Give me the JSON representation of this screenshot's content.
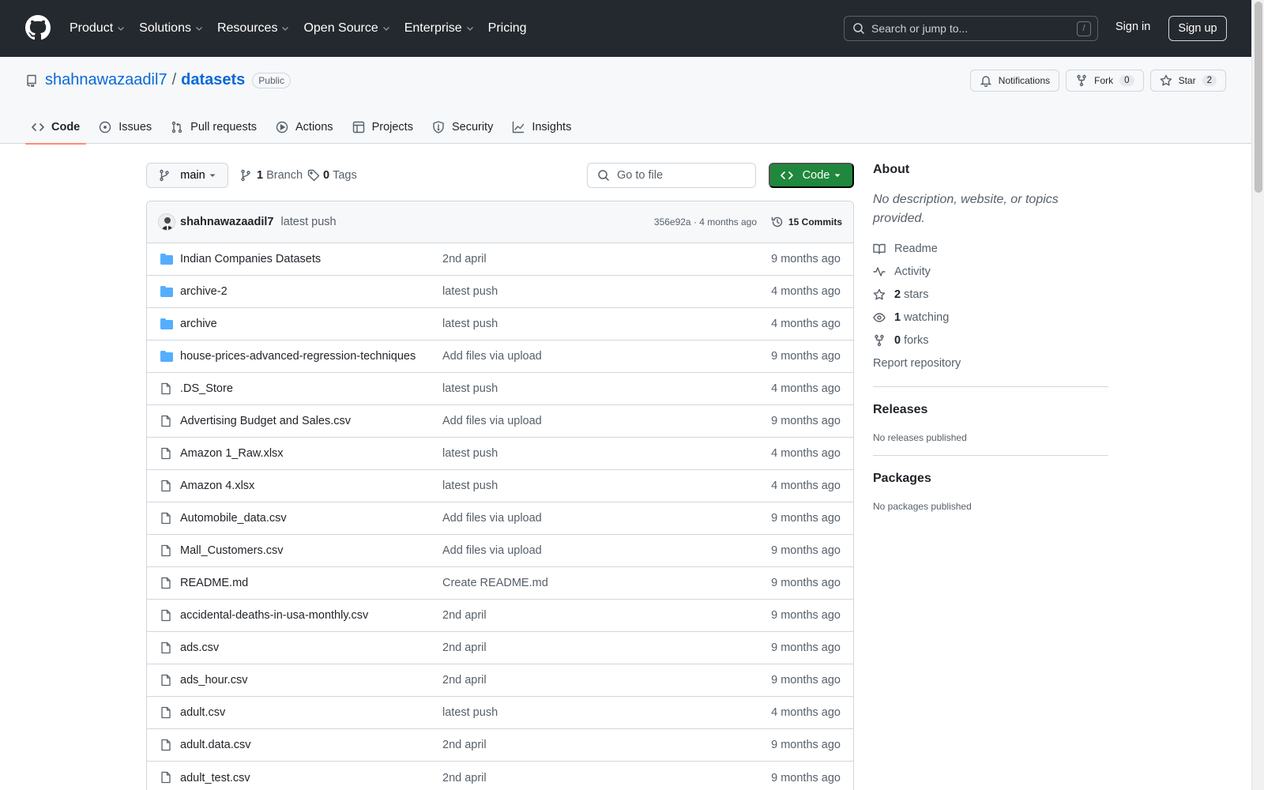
{
  "header": {
    "nav": [
      {
        "label": "Product",
        "has_caret": true
      },
      {
        "label": "Solutions",
        "has_caret": true
      },
      {
        "label": "Resources",
        "has_caret": true
      },
      {
        "label": "Open Source",
        "has_caret": true
      },
      {
        "label": "Enterprise",
        "has_caret": true
      },
      {
        "label": "Pricing",
        "has_caret": false
      }
    ],
    "search_placeholder": "Search or jump to...",
    "search_key": "/",
    "sign_in": "Sign in",
    "sign_up": "Sign up"
  },
  "repo": {
    "owner": "shahnawazaadil7",
    "separator": "/",
    "name": "datasets",
    "visibility": "Public",
    "notifications_label": "Notifications",
    "fork_label": "Fork",
    "fork_count": "0",
    "star_label": "Star",
    "star_count": "2"
  },
  "tabs": [
    {
      "label": "Code",
      "icon": "code-icon",
      "active": true
    },
    {
      "label": "Issues",
      "icon": "issue-icon",
      "active": false
    },
    {
      "label": "Pull requests",
      "icon": "pull-request-icon",
      "active": false
    },
    {
      "label": "Actions",
      "icon": "play-icon",
      "active": false
    },
    {
      "label": "Projects",
      "icon": "table-icon",
      "active": false
    },
    {
      "label": "Security",
      "icon": "shield-icon",
      "active": false
    },
    {
      "label": "Insights",
      "icon": "graph-icon",
      "active": false
    }
  ],
  "toolbar": {
    "branch": "main",
    "branch_count": "1",
    "branch_label": "Branch",
    "tag_count": "0",
    "tag_label": "Tags",
    "goto_placeholder": "Go to file",
    "code_button": "Code"
  },
  "latest_commit": {
    "author": "shahnawazaadil7",
    "message": "latest push",
    "meta": "356e92a · 4 months ago",
    "commits": "15 Commits"
  },
  "files": [
    {
      "type": "dir",
      "name": "Indian Companies Datasets",
      "commit": "2nd april",
      "age": "9 months ago"
    },
    {
      "type": "dir",
      "name": "archive-2",
      "commit": "latest push",
      "age": "4 months ago"
    },
    {
      "type": "dir",
      "name": "archive",
      "commit": "latest push",
      "age": "4 months ago"
    },
    {
      "type": "dir",
      "name": "house-prices-advanced-regression-techniques",
      "commit": "Add files via upload",
      "age": "9 months ago"
    },
    {
      "type": "file",
      "name": ".DS_Store",
      "commit": "latest push",
      "age": "4 months ago"
    },
    {
      "type": "file",
      "name": "Advertising Budget and Sales.csv",
      "commit": "Add files via upload",
      "age": "9 months ago"
    },
    {
      "type": "file",
      "name": "Amazon 1_Raw.xlsx",
      "commit": "latest push",
      "age": "4 months ago"
    },
    {
      "type": "file",
      "name": "Amazon 4.xlsx",
      "commit": "latest push",
      "age": "4 months ago"
    },
    {
      "type": "file",
      "name": "Automobile_data.csv",
      "commit": "Add files via upload",
      "age": "9 months ago"
    },
    {
      "type": "file",
      "name": "Mall_Customers.csv",
      "commit": "Add files via upload",
      "age": "9 months ago"
    },
    {
      "type": "file",
      "name": "README.md",
      "commit": "Create README.md",
      "age": "9 months ago"
    },
    {
      "type": "file",
      "name": "accidental-deaths-in-usa-monthly.csv",
      "commit": "2nd april",
      "age": "9 months ago"
    },
    {
      "type": "file",
      "name": "ads.csv",
      "commit": "2nd april",
      "age": "9 months ago"
    },
    {
      "type": "file",
      "name": "ads_hour.csv",
      "commit": "2nd april",
      "age": "9 months ago"
    },
    {
      "type": "file",
      "name": "adult.csv",
      "commit": "latest push",
      "age": "4 months ago"
    },
    {
      "type": "file",
      "name": "adult.data.csv",
      "commit": "2nd april",
      "age": "9 months ago"
    },
    {
      "type": "file",
      "name": "adult_test.csv",
      "commit": "2nd april",
      "age": "9 months ago"
    }
  ],
  "about": {
    "title": "About",
    "description": "No description, website, or topics provided.",
    "readme": "Readme",
    "activity": "Activity",
    "stars_count": "2",
    "stars_label": "stars",
    "watching_count": "1",
    "watching_label": "watching",
    "forks_count": "0",
    "forks_label": "forks",
    "report": "Report repository"
  },
  "releases": {
    "title": "Releases",
    "empty": "No releases published"
  },
  "packages": {
    "title": "Packages",
    "empty": "No packages published"
  },
  "colors": {
    "header_bg": "#24292f",
    "link": "#0969da",
    "primary_button": "#1f883d",
    "folder": "#54aeff",
    "active_tab_underline": "#fd8c73"
  }
}
